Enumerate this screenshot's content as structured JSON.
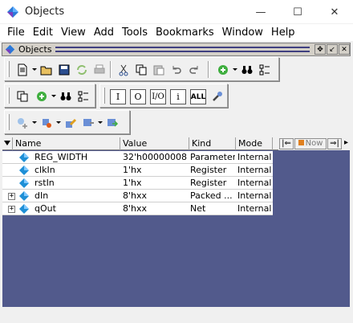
{
  "window": {
    "title": "Objects",
    "minimize": "—",
    "maximize": "☐",
    "close": "✕"
  },
  "menu": [
    "File",
    "Edit",
    "View",
    "Add",
    "Tools",
    "Bookmarks",
    "Window",
    "Help"
  ],
  "panel": {
    "title": "Objects",
    "buttons": [
      "✥",
      "↙",
      "✕"
    ]
  },
  "toolbar": {
    "filter_buttons": [
      "I",
      "O",
      "I/O",
      "i",
      "ALL"
    ]
  },
  "table": {
    "columns": [
      "Name",
      "Value",
      "Kind",
      "Mode"
    ],
    "rows": [
      {
        "name": "REG_WIDTH",
        "value": "32'h00000008",
        "kind": "Parameter",
        "mode": "Internal",
        "expandable": false
      },
      {
        "name": "clkIn",
        "value": "1'hx",
        "kind": "Register",
        "mode": "Internal",
        "expandable": false
      },
      {
        "name": "rstIn",
        "value": "1'hx",
        "kind": "Register",
        "mode": "Internal",
        "expandable": false
      },
      {
        "name": "dIn",
        "value": "8'hxx",
        "kind": "Packed ...",
        "mode": "Internal",
        "expandable": true
      },
      {
        "name": "qOut",
        "value": "8'hxx",
        "kind": "Net",
        "mode": "Internal",
        "expandable": true
      }
    ]
  },
  "now_nav": {
    "label": "Now"
  },
  "colors": {
    "table_background": "#525a8c",
    "signal_icon": "#1e8fd6"
  }
}
